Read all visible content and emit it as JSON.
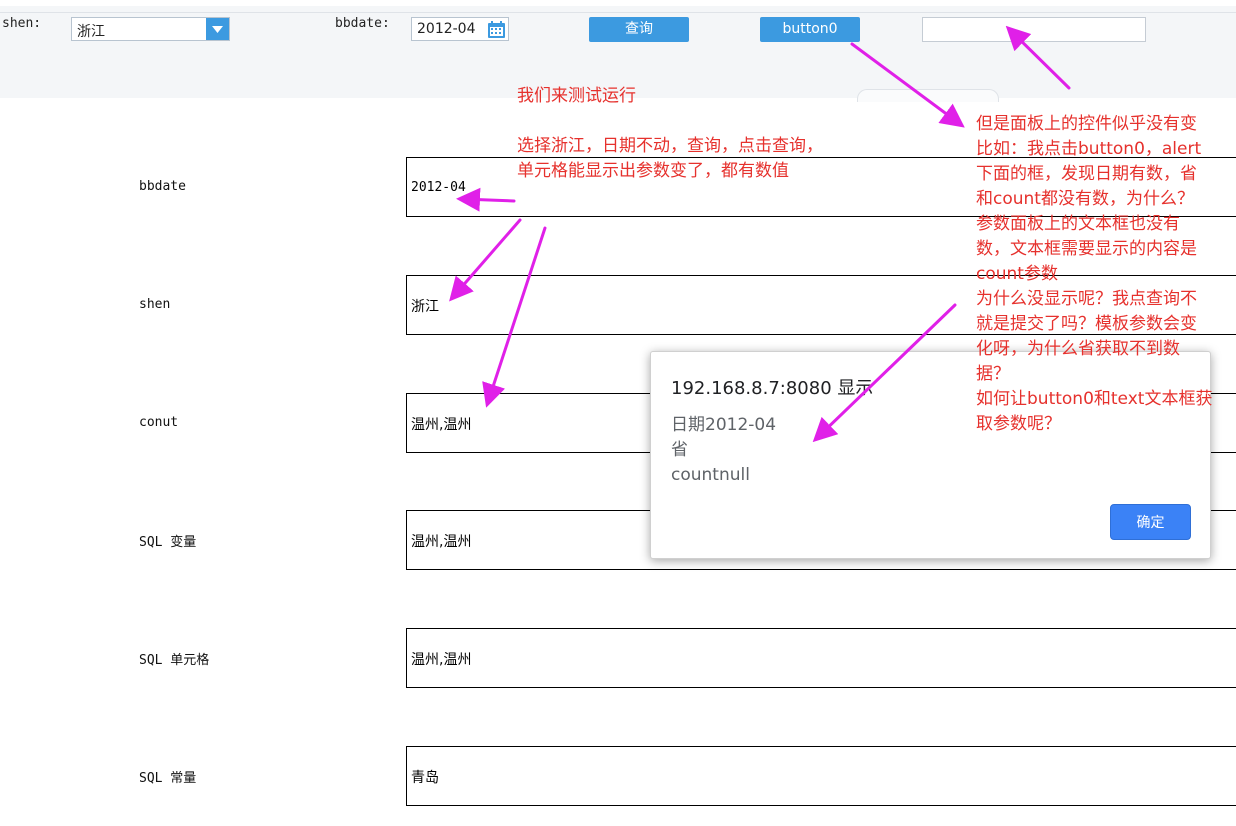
{
  "toolbar": {
    "shen_label": "shen:",
    "shen_value": "浙江",
    "bbdate_label": "bbdate:",
    "bbdate_value": "2012-04",
    "query_button": "查询",
    "button0_label": "button0",
    "text_value": ""
  },
  "rows": [
    {
      "label": "bbdate",
      "value": "2012-04"
    },
    {
      "label": "shen",
      "value": "浙江"
    },
    {
      "label": "conut",
      "value": "温州,温州"
    },
    {
      "label": "SQL 变量",
      "value": "温州,温州"
    },
    {
      "label": "SQL 单元格",
      "value": "温州,温州"
    },
    {
      "label": "SQL 常量",
      "value": "青岛"
    }
  ],
  "notes": {
    "left": "我们来测试运行\n\n选择浙江，日期不动，查询，点击查询，\n单元格能显示出参数变了，都有数值",
    "right": "但是面板上的控件似乎没有变\n比如：我点击button0，alert\n下面的框，发现日期有数，省\n和count都没有数，为什么？\n参数面板上的文本框也没有\n数，文本框需要显示的内容是\ncount参数\n为什么没显示呢？我点查询不\n就是提交了吗？模板参数会变\n化呀，为什么省获取不到数\n据？\n如何让button0和text文本框获\n取参数呢？"
  },
  "dialog": {
    "title": "192.168.8.7:8080 显示",
    "message": "日期2012-04\n省\ncountnull",
    "ok_button": "确定"
  },
  "colors": {
    "accent": "#3c9ae0",
    "note_red": "#e6312d",
    "arrow_magenta": "#e020e8",
    "dialog_button": "#3b82f6"
  }
}
